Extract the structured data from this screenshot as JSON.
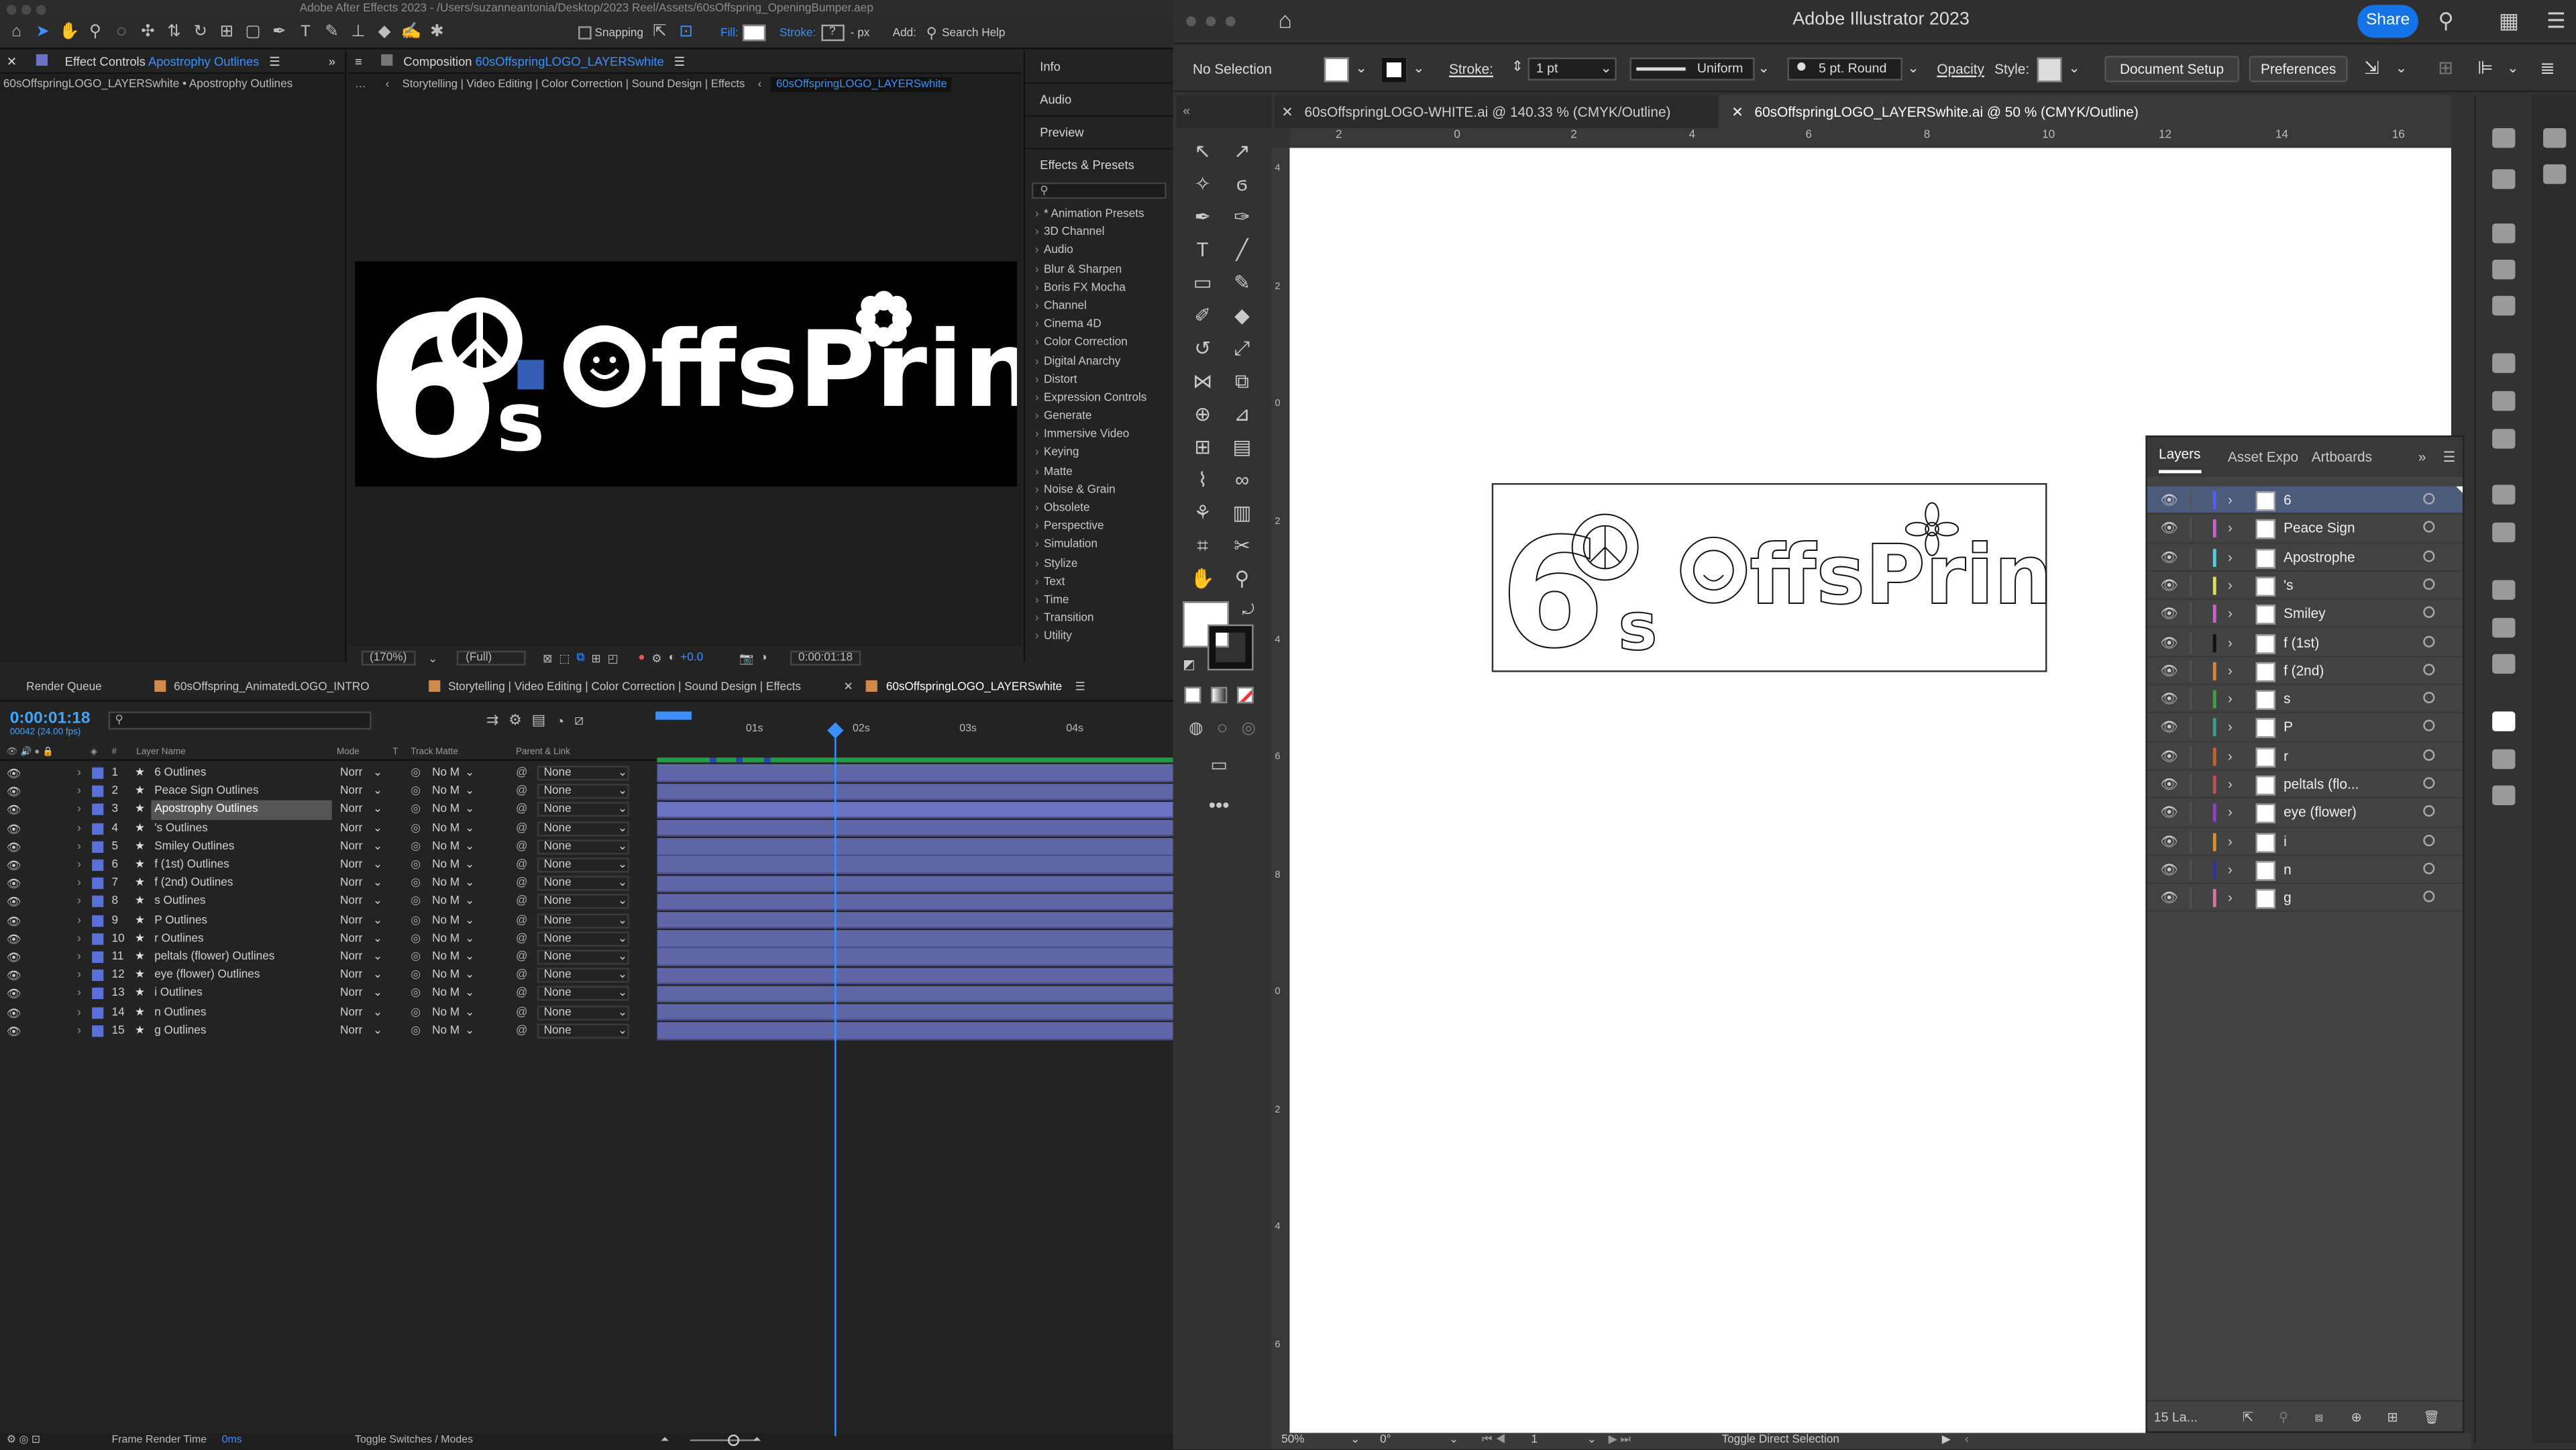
{
  "ae": {
    "window_title": "Adobe After Effects 2023 - /Users/suzanneantonia/Desktop/2023 Reel/Assets/60sOffspring_OpeningBumper.aep",
    "toolbar": {
      "snapping": "Snapping",
      "fill": "Fill:",
      "stroke": "Stroke:",
      "stroke_val": "?",
      "px": "- px",
      "add": "Add:",
      "search": "Search Help"
    },
    "effect_controls": {
      "title": "Effect Controls",
      "layer": "Apostrophy Outlines",
      "subtitle": "60sOffspringLOGO_LAYERSwhite • Apostrophy Outlines"
    },
    "composition": {
      "title": "Composition",
      "name": "60sOffspringLOGO_LAYERSwhite",
      "crumb1": "Storytelling | Video Editing | Color Correction | Sound Design | Effects",
      "crumb2": "60sOffspringLOGO_LAYERSwhite",
      "zoom": "(170%)",
      "resolution": "(Full)",
      "exposure": "+0.0",
      "time": "0:00:01:18"
    },
    "right_panels": [
      "Info",
      "Audio",
      "Preview",
      "Effects & Presets"
    ],
    "effects": [
      "* Animation Presets",
      "3D Channel",
      "Audio",
      "Blur & Sharpen",
      "Boris FX Mocha",
      "Channel",
      "Cinema 4D",
      "Color Correction",
      "Digital Anarchy",
      "Distort",
      "Expression Controls",
      "Generate",
      "Immersive Video",
      "Keying",
      "Matte",
      "Noise & Grain",
      "Obsolete",
      "Perspective",
      "Simulation",
      "Stylize",
      "Text",
      "Time",
      "Transition",
      "Utility"
    ],
    "tabs": [
      "Render Queue",
      "60sOffspring_AnimatedLOGO_INTRO",
      "Storytelling | Video Editing | Color Correction | Sound Design | Effects",
      "60sOffspringLOGO_LAYERSwhite"
    ],
    "timecode": "0:00:01:18",
    "fps": "00042 (24.00 fps)",
    "columns": {
      "name": "Layer Name",
      "mode": "Mode",
      "t": "T",
      "track": "Track Matte",
      "parent": "Parent & Link"
    },
    "ruler": [
      "01s",
      "02s",
      "03s",
      "04s"
    ],
    "layers": [
      {
        "n": "1",
        "name": "6 Outlines"
      },
      {
        "n": "2",
        "name": "Peace Sign Outlines"
      },
      {
        "n": "3",
        "name": "Apostrophy Outlines"
      },
      {
        "n": "4",
        "name": "'s Outlines"
      },
      {
        "n": "5",
        "name": "Smiley Outlines"
      },
      {
        "n": "6",
        "name": "f (1st) Outlines"
      },
      {
        "n": "7",
        "name": "f (2nd) Outlines"
      },
      {
        "n": "8",
        "name": "s Outlines"
      },
      {
        "n": "9",
        "name": "P Outlines"
      },
      {
        "n": "10",
        "name": "r Outlines"
      },
      {
        "n": "11",
        "name": "peltals (flower) Outlines"
      },
      {
        "n": "12",
        "name": "eye (flower) Outlines"
      },
      {
        "n": "13",
        "name": "i Outlines"
      },
      {
        "n": "14",
        "name": "n Outlines"
      },
      {
        "n": "15",
        "name": "g Outlines"
      }
    ],
    "mode_val": "Norr",
    "track_val": "No M",
    "parent_val": "None",
    "status": {
      "frt": "Frame Render Time",
      "frt_val": "0ms",
      "toggle": "Toggle Switches / Modes"
    }
  },
  "ai": {
    "title": "Adobe Illustrator 2023",
    "share": "Share",
    "control": {
      "selection": "No Selection",
      "stroke": "Stroke:",
      "stroke_w": "1 pt",
      "uniform": "Uniform",
      "round": "5 pt. Round",
      "opacity": "Opacity",
      "style": "Style:",
      "doc_setup": "Document Setup",
      "prefs": "Preferences"
    },
    "doc_tabs": [
      "60sOffspringLOGO-WHITE.ai @ 140.33 % (CMYK/Outline)",
      "60sOffspringLOGO_LAYERSwhite.ai @ 50 % (CMYK/Outline)"
    ],
    "hruler": [
      "2",
      "0",
      "2",
      "4",
      "6",
      "8",
      "10",
      "12",
      "14",
      "16"
    ],
    "vruler": [
      "4",
      "2",
      "0",
      "2",
      "4",
      "6",
      "8",
      "0",
      "2",
      "4",
      "6"
    ],
    "layers_tabs": [
      "Layers",
      "Asset Expo",
      "Artboards"
    ],
    "layers": [
      {
        "name": "6",
        "color": "#4f5cff"
      },
      {
        "name": "Peace Sign",
        "color": "#cf5fcf"
      },
      {
        "name": "Apostrophe",
        "color": "#4fd0e0"
      },
      {
        "name": "'s",
        "color": "#e0e050"
      },
      {
        "name": "Smiley",
        "color": "#cf5fcf"
      },
      {
        "name": "f (1st)",
        "color": "#111111"
      },
      {
        "name": "f (2nd)",
        "color": "#e08030"
      },
      {
        "name": "s",
        "color": "#40a040"
      },
      {
        "name": "P",
        "color": "#30a090"
      },
      {
        "name": "r",
        "color": "#c06030"
      },
      {
        "name": "peltals (flo...",
        "color": "#c05050"
      },
      {
        "name": "eye (flower)",
        "color": "#8a40d0"
      },
      {
        "name": "i",
        "color": "#e09020"
      },
      {
        "name": "n",
        "color": "#3030a0"
      },
      {
        "name": "g",
        "color": "#e070a0"
      }
    ],
    "layers_count": "15 La...",
    "status": {
      "zoom": "50%",
      "angle": "0°",
      "artboard": "1",
      "hint": "Toggle Direct Selection"
    }
  },
  "logo": {
    "main": "ffsPring",
    "digit": "6",
    "s": "s"
  }
}
